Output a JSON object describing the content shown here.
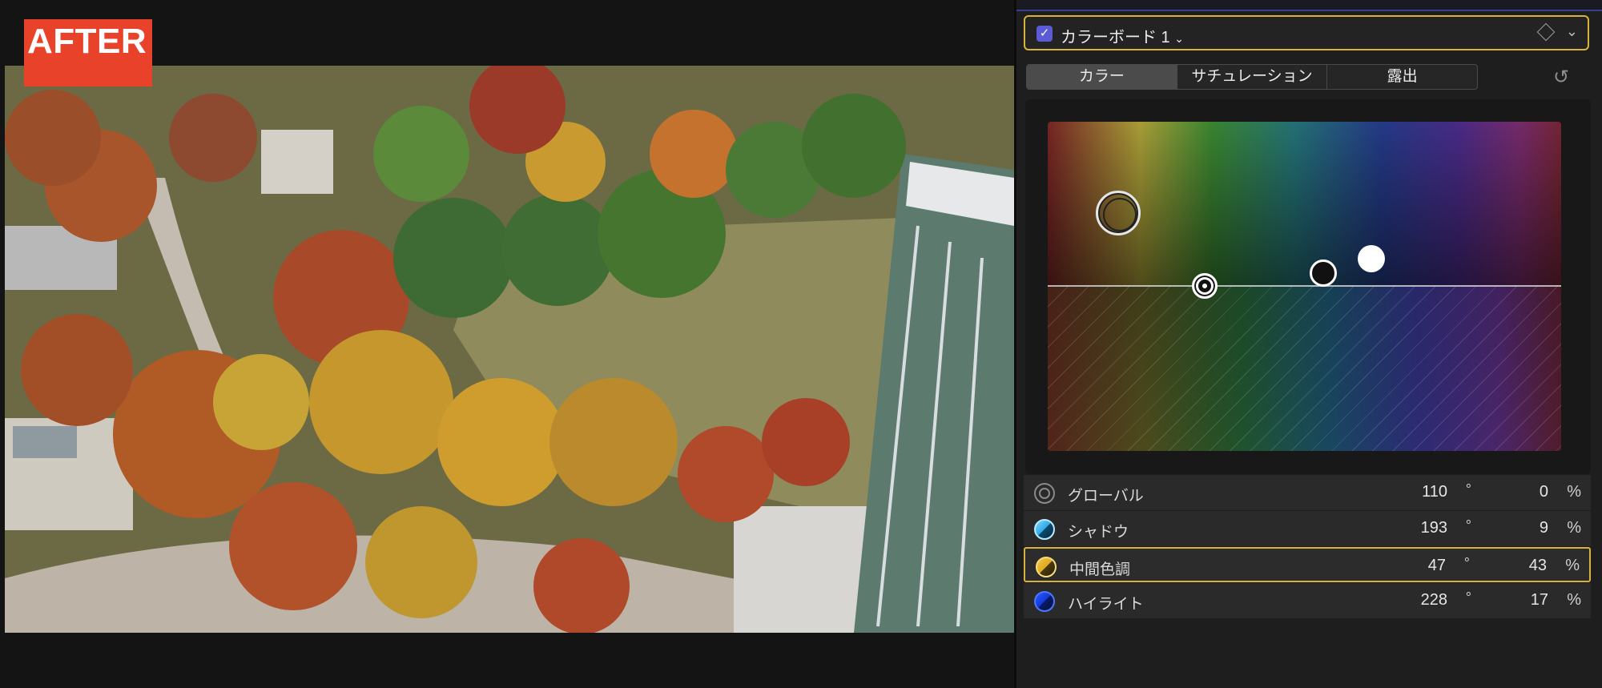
{
  "viewer": {
    "badge_text": "AFTER"
  },
  "inspector": {
    "board_header": {
      "checked": true,
      "title": "カラーボード 1",
      "title_chevron": "chevron-down-icon",
      "keyframe_icon": "diamond-icon",
      "menu_icon": "chevron-down-icon",
      "border_color": "#d8b33a"
    },
    "tabs": [
      {
        "label": "カラー",
        "active": true
      },
      {
        "label": "サチュレーション",
        "active": false
      },
      {
        "label": "露出",
        "active": false
      }
    ],
    "reset_icon": "undo-icon",
    "rows": [
      {
        "label": "グローバル",
        "angle": "110",
        "deg": "°",
        "percent": "0",
        "pct": "%",
        "icon": "global-icon",
        "selected": false
      },
      {
        "label": "シャドウ",
        "angle": "193",
        "deg": "°",
        "percent": "9",
        "pct": "%",
        "icon": "shadows-icon",
        "selected": false
      },
      {
        "label": "中間色調",
        "angle": "47",
        "deg": "°",
        "percent": "43",
        "pct": "%",
        "icon": "midtones-icon",
        "selected": true
      },
      {
        "label": "ハイライト",
        "angle": "228",
        "deg": "°",
        "percent": "17",
        "pct": "%",
        "icon": "highlights-icon",
        "selected": false
      }
    ]
  }
}
